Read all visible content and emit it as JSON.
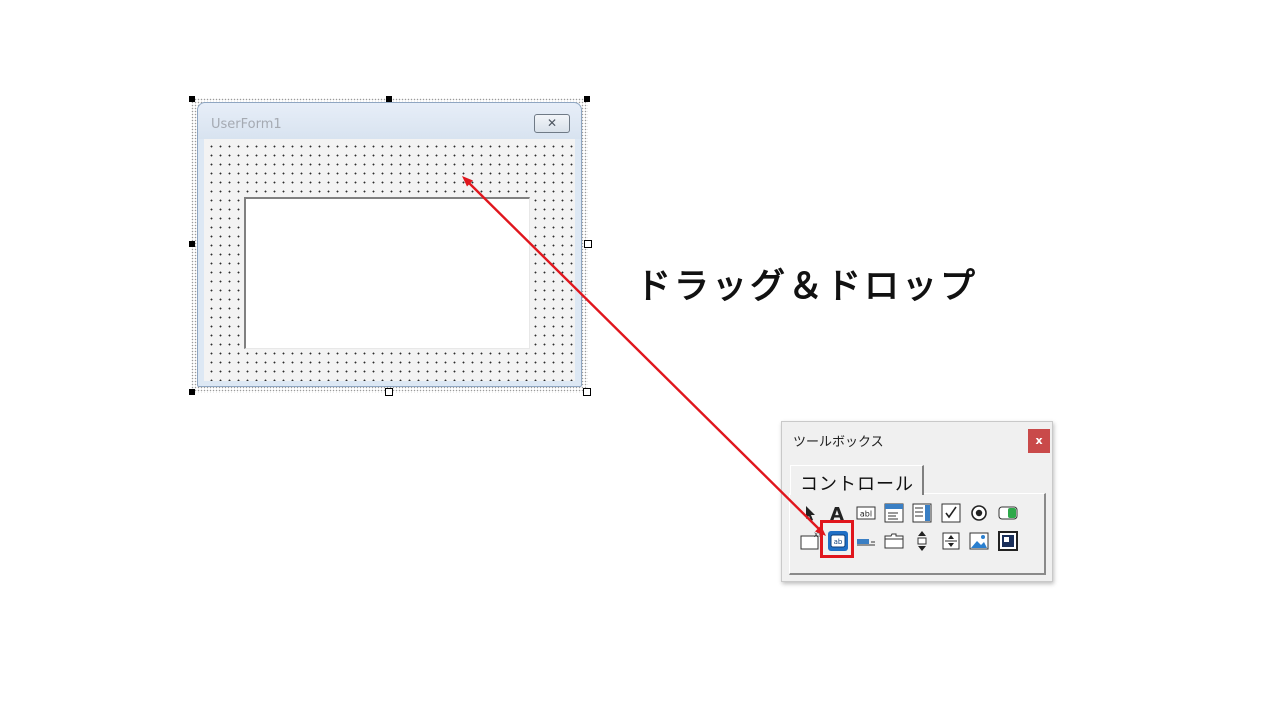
{
  "userform": {
    "title": "UserForm1",
    "close_glyph": "✕"
  },
  "caption": "ドラッグ＆ドロップ",
  "toolbox": {
    "title": "ツールボックス",
    "close_glyph": "x",
    "tab_label": "コントロール",
    "tools_row1": [
      "select-objects-icon",
      "label-icon",
      "textbox-icon",
      "combobox-icon",
      "listbox-icon",
      "checkbox-icon",
      "optionbutton-icon",
      "togglebutton-icon"
    ],
    "tools_row2": [
      "frame-icon",
      "commandbutton-icon",
      "tabstrip-icon",
      "multipage-icon",
      "scrollbar-icon",
      "spinbutton-icon",
      "image-icon",
      "refedit-icon"
    ],
    "highlighted_tool": "commandbutton-icon"
  },
  "colors": {
    "arrow": "#e0161d",
    "highlight": "#e0161d",
    "toolbox_close": "#c94a4a"
  }
}
